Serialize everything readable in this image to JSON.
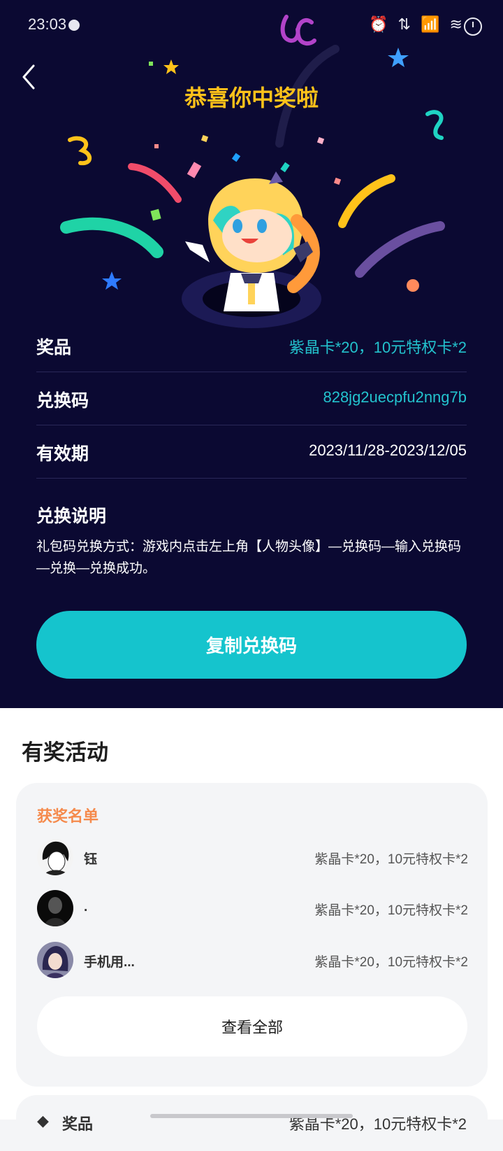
{
  "status_bar": {
    "time": "23:03",
    "icons": "⏰ ⇅ 📶 ≋"
  },
  "header": {
    "title": "恭喜你中奖啦"
  },
  "prize_info": [
    {
      "label": "奖品",
      "value": "紫晶卡*20，10元特权卡*2"
    },
    {
      "label": "兑换码",
      "value": "828jg2uecpfu2nng7b"
    },
    {
      "label": "有效期",
      "value": "2023/11/28-2023/12/05"
    }
  ],
  "instructions": {
    "label": "兑换说明",
    "text": "礼包码兑换方式：游戏内点击左上角【人物头像】—兑换码—输入兑换码—兑换—兑换成功。"
  },
  "copy_button": {
    "label": "复制兑换码"
  },
  "activities": {
    "title": "有奖活动",
    "winner_list": {
      "title": "获奖名单",
      "winners": [
        {
          "name": "钰",
          "prize": "紫晶卡*20，10元特权卡*2"
        },
        {
          "name": ".",
          "prize": "紫晶卡*20，10元特权卡*2"
        },
        {
          "name": "手机用...",
          "prize": "紫晶卡*20，10元特权卡*2"
        }
      ],
      "view_all_label": "查看全部"
    },
    "next_card": {
      "label": "奖品",
      "value": "紫晶卡*20，10元特权卡*2"
    }
  },
  "colors": {
    "background": "#0b0932",
    "accent": "#15c4cd",
    "title": "#ffc21a",
    "winner_title": "#f58a4c"
  }
}
